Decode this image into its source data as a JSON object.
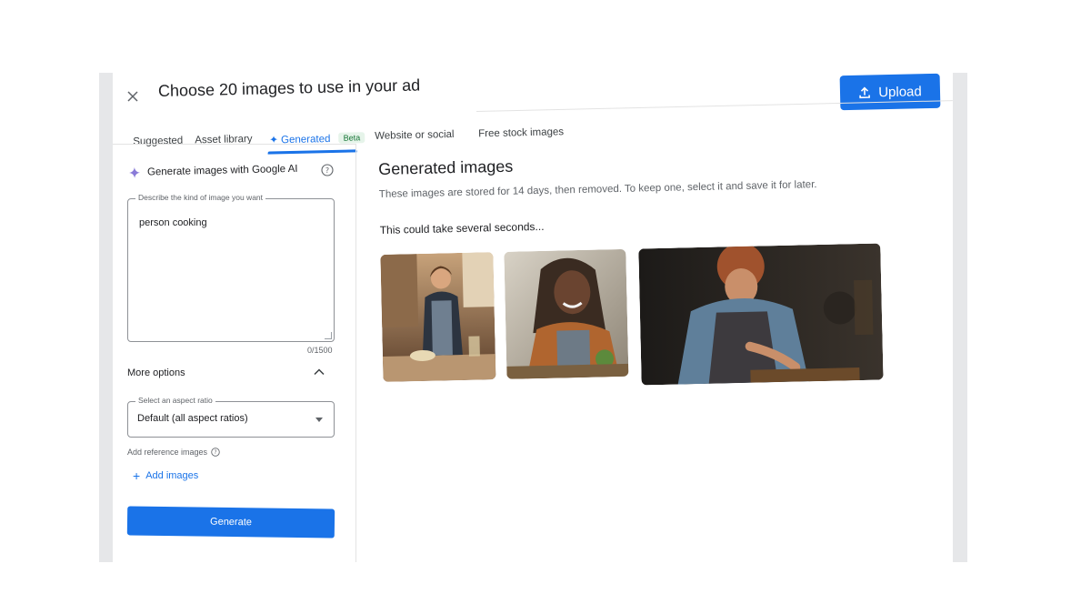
{
  "dialog": {
    "title": "Choose 20 images to use in your ad",
    "upload_label": "Upload"
  },
  "tabs": [
    {
      "label": "Suggested"
    },
    {
      "label": "Asset library"
    },
    {
      "label": "Generated",
      "badge": "Beta",
      "active": true
    },
    {
      "label": "Website or social"
    },
    {
      "label": "Free stock images"
    }
  ],
  "left_panel": {
    "heading": "Generate images with Google AI",
    "prompt_label": "Describe the kind of image you want",
    "prompt_value": "person cooking",
    "char_counter": "0/1500",
    "more_options": "More options",
    "aspect_label": "Select an aspect ratio",
    "aspect_value": "Default (all aspect ratios)",
    "reference_label": "Add reference images",
    "add_images": "Add images",
    "generate": "Generate"
  },
  "right_panel": {
    "title": "Generated images",
    "description": "These images are stored for 14 days, then removed. To keep one, select it and save it for later.",
    "status": "This could take several seconds..."
  },
  "icons": {
    "close": "close-icon",
    "upload": "upload-icon",
    "sparkle": "sparkle-icon",
    "help": "help-icon",
    "chevron": "chevron-up-icon",
    "dropdown": "dropdown-arrow-icon",
    "add": "plus-icon"
  },
  "colors": {
    "accent": "#1a73e8",
    "beta_bg": "#e6f4ea",
    "beta_text": "#137333",
    "bezel": "#e6e7e9"
  }
}
